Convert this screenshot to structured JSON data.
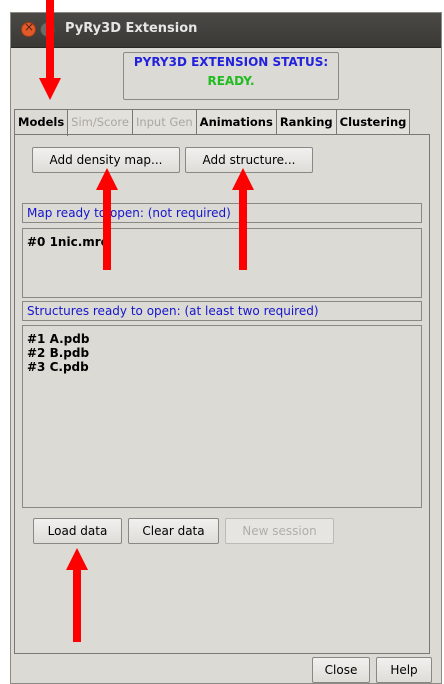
{
  "window": {
    "title": "PyRy3D Extension"
  },
  "status": {
    "title": "PYRY3D EXTENSION STATUS:",
    "value": "READY."
  },
  "tabs": [
    {
      "label": "Models",
      "state": "active"
    },
    {
      "label": "Sim/Score",
      "state": "disabled"
    },
    {
      "label": "Input Gen",
      "state": "disabled"
    },
    {
      "label": "Animations",
      "state": "enabled"
    },
    {
      "label": "Ranking",
      "state": "enabled"
    },
    {
      "label": "Clustering",
      "state": "enabled"
    }
  ],
  "models": {
    "add_density_label": "Add density map...",
    "add_structure_label": "Add structure...",
    "map_header": "Map ready to open: (not required)",
    "maps": [
      "#0 1nic.mrc"
    ],
    "structures_header": "Structures ready to open: (at least two required)",
    "structures": [
      "#1 A.pdb",
      "#2 B.pdb",
      "#3 C.pdb"
    ],
    "load_label": "Load data",
    "clear_label": "Clear data",
    "new_session_label": "New session"
  },
  "footer": {
    "close_label": "Close",
    "help_label": "Help"
  },
  "colors": {
    "status_title": "#2222dd",
    "status_ready": "#22bb22",
    "section_header": "#1515cc",
    "annotation_arrow": "#ff0000"
  }
}
